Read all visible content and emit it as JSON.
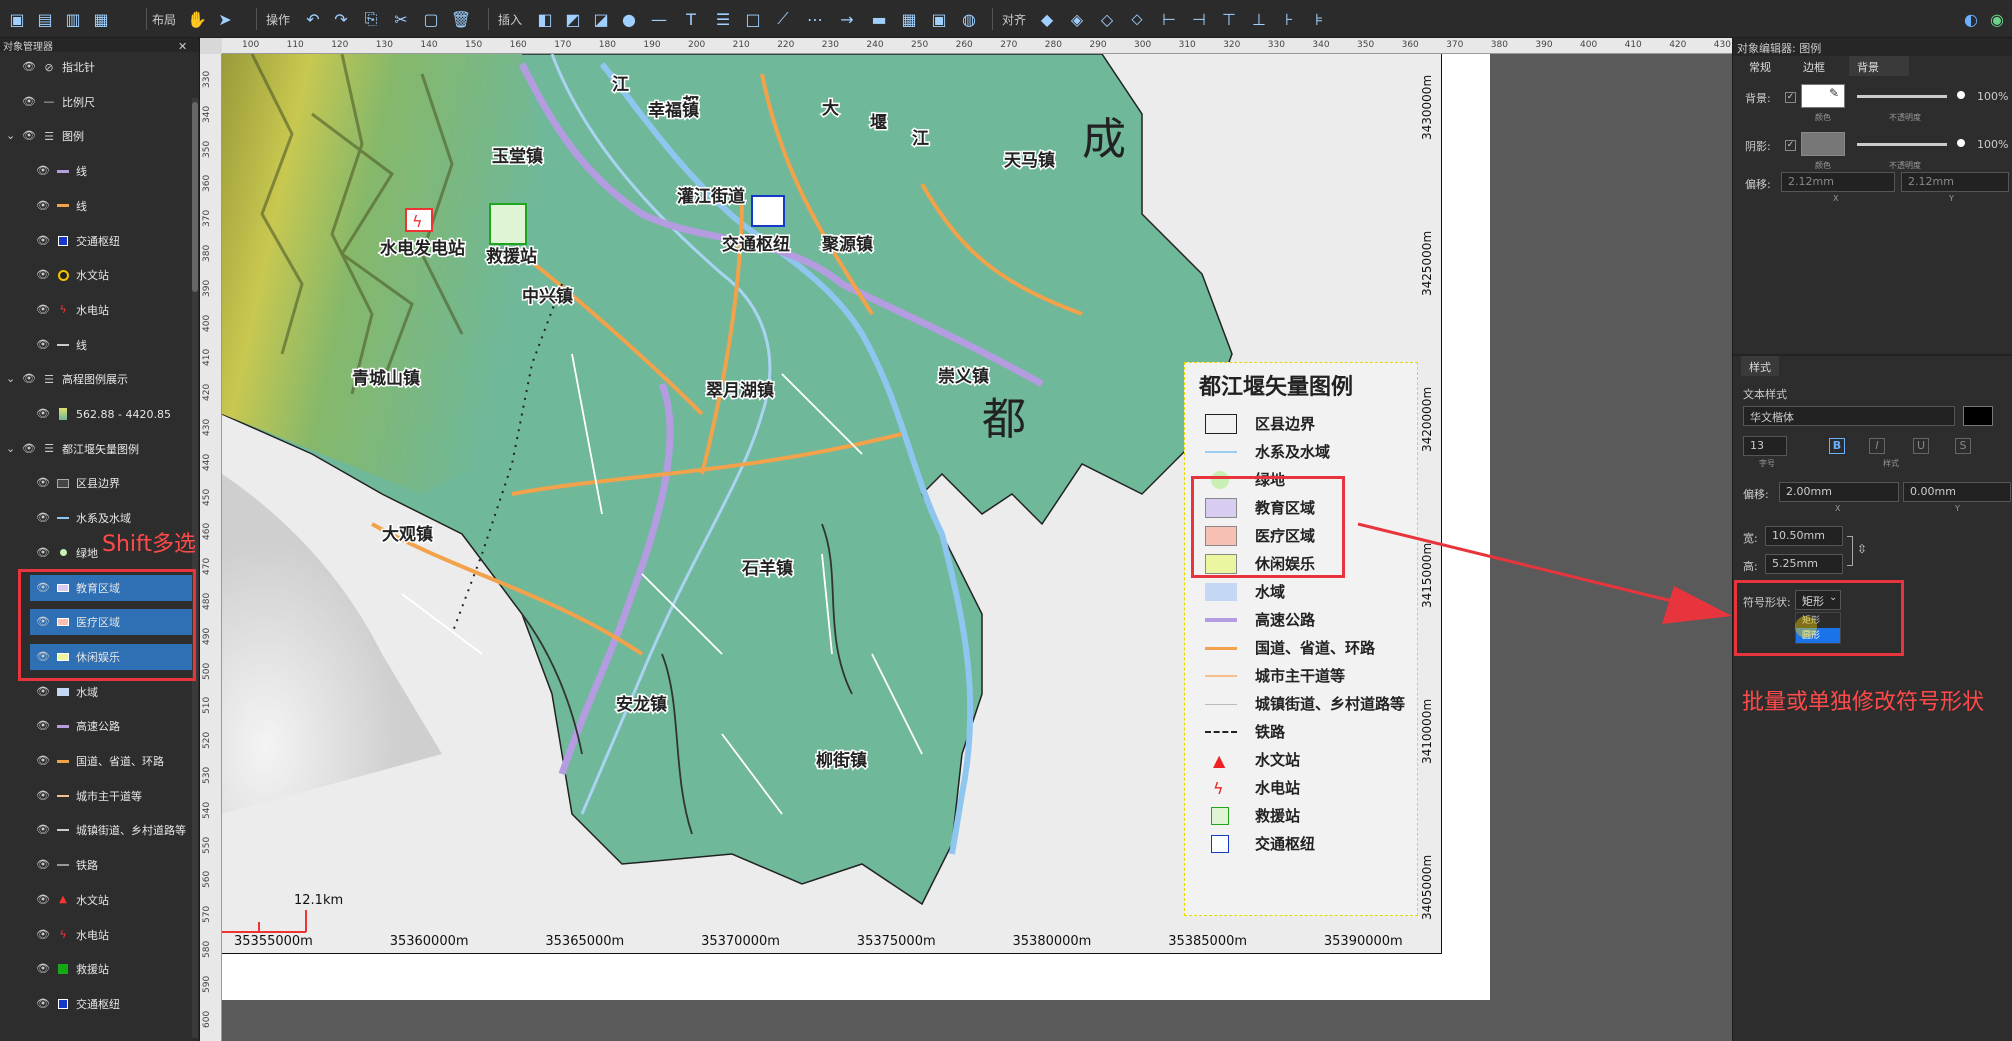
{
  "toolbar": {
    "layout_label": "布局",
    "operate_label": "操作",
    "insert_label": "插入",
    "align_label": "对齐"
  },
  "object_manager": {
    "title": "对象管理器",
    "items": [
      {
        "label": "指北针",
        "indent": 1,
        "symbol": "compass"
      },
      {
        "label": "比例尺",
        "indent": 1,
        "symbol": "dash"
      },
      {
        "label": "图例",
        "indent": 0,
        "symbol": "list"
      },
      {
        "label": "线",
        "indent": 2,
        "symbol": "line-purple"
      },
      {
        "label": "线",
        "indent": 2,
        "symbol": "line-orange"
      },
      {
        "label": "交通枢纽",
        "indent": 2,
        "symbol": "transit"
      },
      {
        "label": "水文站",
        "indent": 2,
        "symbol": "hydro-circle"
      },
      {
        "label": "水电站",
        "indent": 2,
        "symbol": "bolt"
      },
      {
        "label": "线",
        "indent": 2,
        "symbol": "line-gray"
      },
      {
        "label": "高程图例展示",
        "indent": 0,
        "symbol": "list"
      },
      {
        "label": "562.88 - 4420.85",
        "indent": 2,
        "symbol": "ramp"
      },
      {
        "label": "都江堰矢量图例",
        "indent": 0,
        "symbol": "list"
      },
      {
        "label": "区县边界",
        "indent": 2,
        "symbol": "rect-dark"
      },
      {
        "label": "水系及水域",
        "indent": 2,
        "symbol": "line-blue"
      },
      {
        "label": "绿地",
        "indent": 2,
        "symbol": "dot-green"
      },
      {
        "label": "教育区域",
        "indent": 2,
        "symbol": "rect-purple",
        "selected": true
      },
      {
        "label": "医疗区域",
        "indent": 2,
        "symbol": "rect-pink",
        "selected": true
      },
      {
        "label": "休闲娱乐",
        "indent": 2,
        "symbol": "rect-yellow",
        "selected": true
      },
      {
        "label": "水域",
        "indent": 2,
        "symbol": "rect-blue"
      },
      {
        "label": "高速公路",
        "indent": 2,
        "symbol": "line-purple"
      },
      {
        "label": "国道、省道、环路",
        "indent": 2,
        "symbol": "line-orange"
      },
      {
        "label": "城市主干道等",
        "indent": 2,
        "symbol": "line-lorange"
      },
      {
        "label": "城镇街道、乡村道路等",
        "indent": 2,
        "symbol": "line-gray"
      },
      {
        "label": "铁路",
        "indent": 2,
        "symbol": "line-dark"
      },
      {
        "label": "水文站",
        "indent": 2,
        "symbol": "red-tri"
      },
      {
        "label": "水电站",
        "indent": 2,
        "symbol": "bolt"
      },
      {
        "label": "救援站",
        "indent": 2,
        "symbol": "rescue"
      },
      {
        "label": "交通枢纽",
        "indent": 2,
        "symbol": "transit"
      }
    ]
  },
  "rulers": {
    "h_ticks": [
      "100",
      "110",
      "120",
      "130",
      "140",
      "150",
      "160",
      "170",
      "180",
      "190",
      "200",
      "210",
      "220",
      "230",
      "240",
      "250",
      "260",
      "270",
      "280",
      "290",
      "300",
      "310",
      "320",
      "330",
      "340",
      "350",
      "360",
      "370",
      "380",
      "390",
      "400",
      "410",
      "420",
      "430"
    ],
    "v_ticks": [
      "330",
      "340",
      "350",
      "360",
      "370",
      "380",
      "390",
      "400",
      "410",
      "420",
      "430",
      "440",
      "450",
      "460",
      "470",
      "480",
      "490",
      "500",
      "510",
      "520",
      "530",
      "540",
      "550",
      "560",
      "570",
      "580",
      "590",
      "600"
    ]
  },
  "map": {
    "towns": [
      "玉堂镇",
      "幸福镇",
      "天马镇",
      "中兴镇",
      "灌江街道",
      "聚源镇",
      "青城山镇",
      "翠月湖镇",
      "崇义镇",
      "大观镇",
      "石羊镇",
      "安龙镇",
      "柳街镇"
    ],
    "pois": [
      "水电发电站",
      "救援站",
      "交通枢纽"
    ],
    "big_labels": [
      "成",
      "都"
    ],
    "road_labels": [
      "江",
      "都",
      "大",
      "堰",
      "江"
    ],
    "scale_label": "12.1km",
    "x_coords": [
      "35355000m",
      "35360000m",
      "35365000m",
      "35370000m",
      "35375000m",
      "35380000m",
      "35385000m",
      "35390000m"
    ],
    "y_coords": [
      "3430000m",
      "3425000m",
      "3420000m",
      "3415000m",
      "3410000m",
      "3405000m"
    ]
  },
  "legend": {
    "title": "都江堰矢量图例",
    "items": [
      "区县边界",
      "水系及水域",
      "绿地",
      "教育区域",
      "医疗区域",
      "休闲娱乐",
      "水域",
      "高速公路",
      "国道、省道、环路",
      "城市主干道等",
      "城镇街道、乡村道路等",
      "铁路",
      "水文站",
      "水电站",
      "救援站",
      "交通枢纽"
    ]
  },
  "right_panel": {
    "title": "对象编辑器: 图例",
    "tabs": [
      "常规",
      "边框",
      "背景"
    ],
    "active_tab": "背景",
    "background_label": "背景:",
    "shadow_label": "阴影:",
    "color_caption": "颜色",
    "opacity_caption": "不透明度",
    "bg_opacity": "100%",
    "shadow_opacity": "100%",
    "offset_label": "偏移:",
    "shadow_offset_x": "2.12mm",
    "shadow_offset_y": "2.12mm",
    "x_caption": "X",
    "y_caption": "Y",
    "style_tab": "样式",
    "text_style_label": "文本样式",
    "font_name": "华文楷体",
    "font_size": "13",
    "size_caption": "字号",
    "style_caption": "样式",
    "text_offset_x": "2.00mm",
    "text_offset_y": "0.00mm",
    "width_label": "宽:",
    "width_value": "10.50mm",
    "height_label": "高:",
    "height_value": "5.25mm",
    "shape_label": "符号形状:",
    "shape_value": "矩形",
    "dropdown_options": [
      "矩形",
      "圆形"
    ]
  },
  "annotations": {
    "shift_select": "Shift多选",
    "batch_modify": "批量或单独修改符号形状"
  },
  "colors": {
    "selection": "#2f6fb3",
    "annotation_red": "#e8343c",
    "map_green": "#6fb89a",
    "highway": "#b49ce0",
    "arterial": "#f2a24a"
  }
}
